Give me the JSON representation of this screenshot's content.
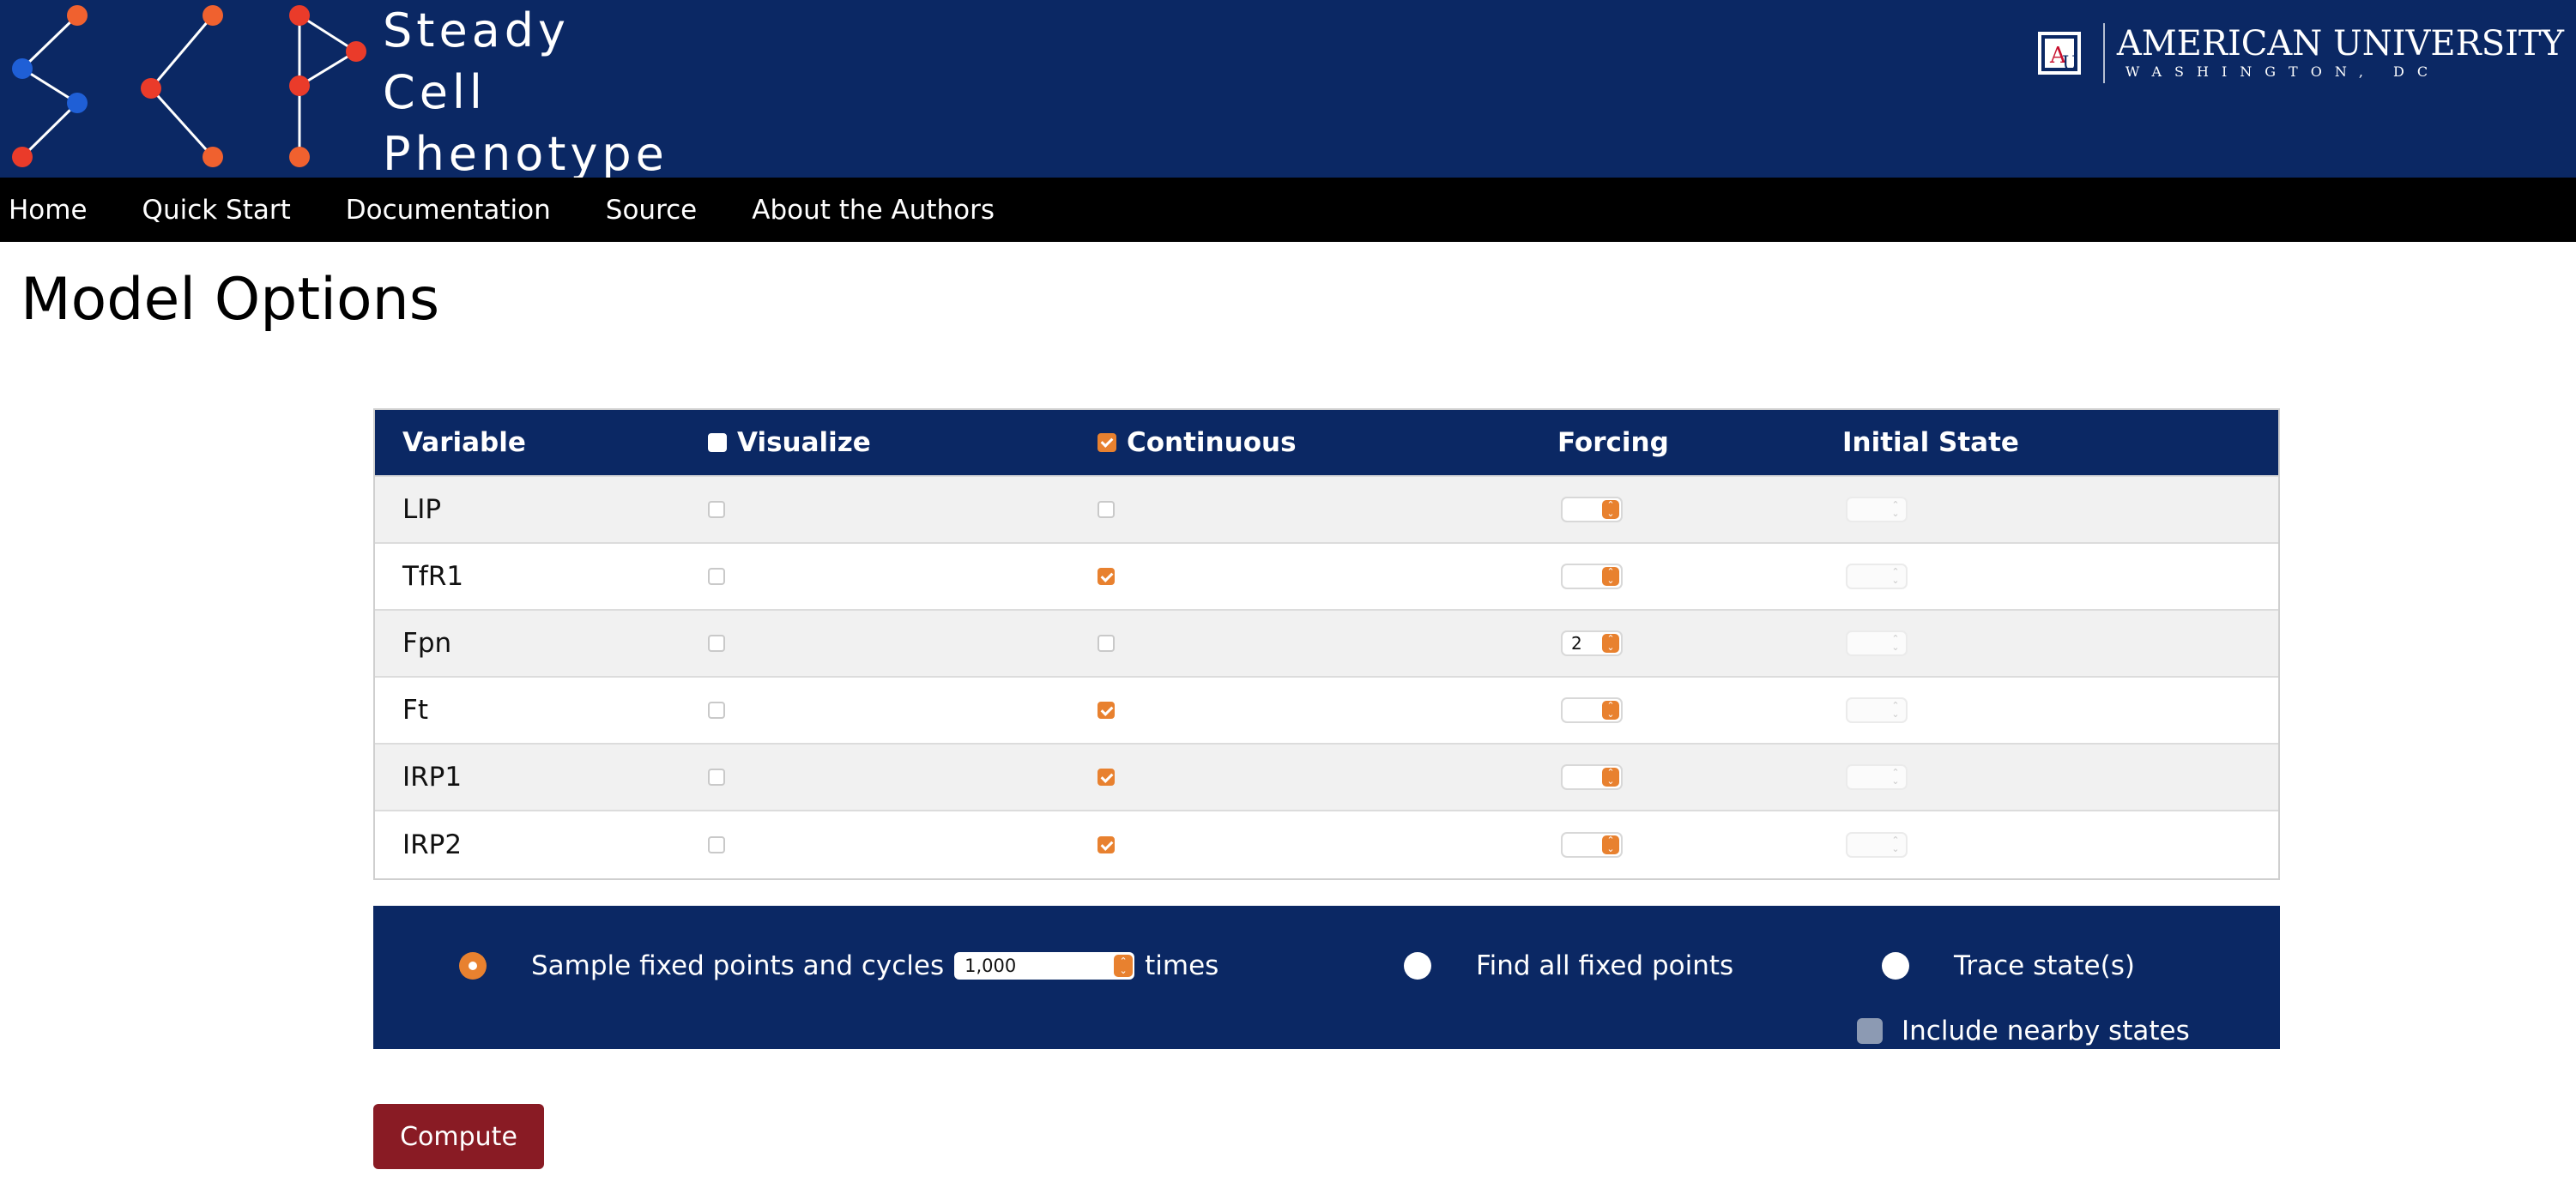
{
  "site": {
    "title_lines": [
      "Steady",
      "Cell",
      "Phenotype"
    ],
    "university_name": "AMERICAN UNIVERSITY",
    "university_city": "WASHINGTON, DC",
    "brand_color": "#0b2864",
    "accent_color": "#e8812f"
  },
  "nav": {
    "items": [
      {
        "label": "Home"
      },
      {
        "label": "Quick Start"
      },
      {
        "label": "Documentation"
      },
      {
        "label": "Source"
      },
      {
        "label": "About the Authors"
      }
    ]
  },
  "page": {
    "title": "Model Options"
  },
  "table": {
    "headers": {
      "variable": "Variable",
      "visualize": "Visualize",
      "continuous": "Continuous",
      "forcing": "Forcing",
      "initial_state": "Initial State"
    },
    "header_visualize_checked": false,
    "header_continuous_checked": true,
    "rows": [
      {
        "variable": "LIP",
        "visualize": false,
        "continuous": false,
        "forcing": "",
        "initial_state": ""
      },
      {
        "variable": "TfR1",
        "visualize": false,
        "continuous": true,
        "forcing": "",
        "initial_state": ""
      },
      {
        "variable": "Fpn",
        "visualize": false,
        "continuous": false,
        "forcing": "2",
        "initial_state": ""
      },
      {
        "variable": "Ft",
        "visualize": false,
        "continuous": true,
        "forcing": "",
        "initial_state": ""
      },
      {
        "variable": "IRP1",
        "visualize": false,
        "continuous": true,
        "forcing": "",
        "initial_state": ""
      },
      {
        "variable": "IRP2",
        "visualize": false,
        "continuous": true,
        "forcing": "",
        "initial_state": ""
      }
    ]
  },
  "options": {
    "sample_label": "Sample fixed points and cycles",
    "sample_count": "1,000",
    "times_label": "times",
    "sample_selected": true,
    "find_all_label": "Find all fixed points",
    "find_all_selected": false,
    "trace_label": "Trace state(s)",
    "trace_selected": false,
    "nearby_label": "Include nearby states",
    "nearby_checked": false
  },
  "actions": {
    "compute_label": "Compute"
  }
}
